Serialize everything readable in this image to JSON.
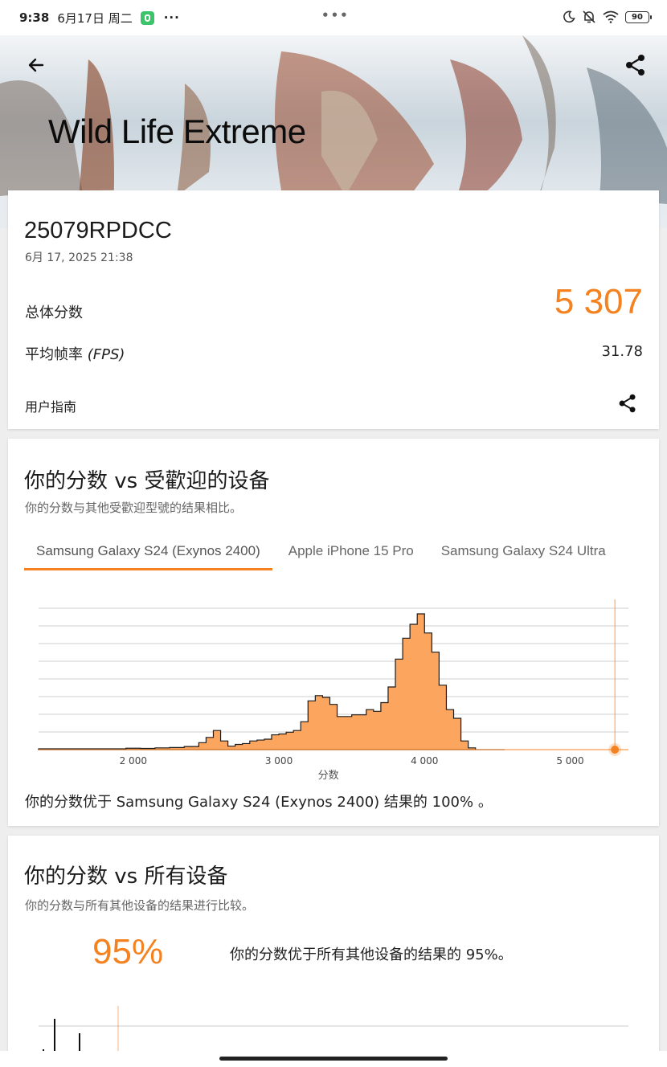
{
  "status_bar": {
    "time": "9:38",
    "date": "6月17日 周二",
    "app_icon": "wechat-style-shield-icon",
    "more": "···",
    "center_dots": "•••",
    "battery": "90"
  },
  "hero": {
    "title": "Wild Life Extreme",
    "back_icon": "arrow-left-icon",
    "share_icon": "share-icon"
  },
  "result": {
    "device": "25079RPDCC",
    "date": "6月 17, 2025 21:38",
    "overall_label": "总体分数",
    "overall_score": "5 307",
    "fps_label": "平均帧率",
    "fps_unit": "(FPS)",
    "fps_value": "31.78",
    "guide_label": "用户指南"
  },
  "popular": {
    "title": "你的分数 vs 受歡迎的设备",
    "subtitle": "你的分数与其他受歡迎型號的结果相比。",
    "tabs": [
      {
        "label": "Samsung Galaxy S24 (Exynos 2400)"
      },
      {
        "label": "Apple iPhone 15 Pro"
      },
      {
        "label": "Samsung Galaxy S24 Ultra"
      }
    ],
    "caption": "你的分数优于 Samsung Galaxy S24 (Exynos 2400) 结果的 100% 。"
  },
  "chart_data": {
    "type": "area",
    "xlabel": "分数",
    "ylabel": "",
    "x_ticks": [
      "2 000",
      "3 000",
      "4 000",
      "5 000"
    ],
    "xlim": [
      1350,
      5400
    ],
    "grid": true,
    "marker_value": 5307,
    "series": [
      {
        "x": [
          1350,
          1450,
          1550,
          1650,
          1750,
          1850,
          1950,
          2050,
          2150,
          2250,
          2350,
          2450,
          2500,
          2550,
          2600,
          2650,
          2700,
          2750,
          2800,
          2850,
          2900,
          2950,
          3000,
          3050,
          3100,
          3150,
          3200,
          3250,
          3300,
          3350,
          3400,
          3450,
          3500,
          3550,
          3600,
          3650,
          3700,
          3750,
          3800,
          3850,
          3900,
          3950,
          4000,
          4050,
          4100,
          4150,
          4200,
          4250,
          4300,
          4350,
          4400,
          4450
        ],
        "values": [
          0.5,
          0.5,
          0.5,
          0.5,
          0.5,
          0.5,
          0.8,
          0.7,
          1.0,
          1.2,
          1.8,
          4,
          7,
          11,
          5,
          2,
          3,
          3.5,
          5,
          5.5,
          6,
          8.5,
          9,
          10,
          11,
          16,
          28,
          31,
          30,
          26,
          19,
          19,
          20,
          20,
          23,
          22,
          27,
          36,
          52,
          64,
          72,
          78,
          67,
          56,
          37,
          23,
          18,
          5,
          1,
          0,
          0,
          0
        ]
      }
    ]
  },
  "all_devices": {
    "title": "你的分数 vs 所有设备",
    "subtitle": "你的分数与所有其他设备的结果进行比较。",
    "percentile": "95%",
    "caption": "你的分数优于所有其他设备的结果的 95%。"
  },
  "colors": {
    "accent": "#f58220",
    "fill": "#fba55e"
  }
}
